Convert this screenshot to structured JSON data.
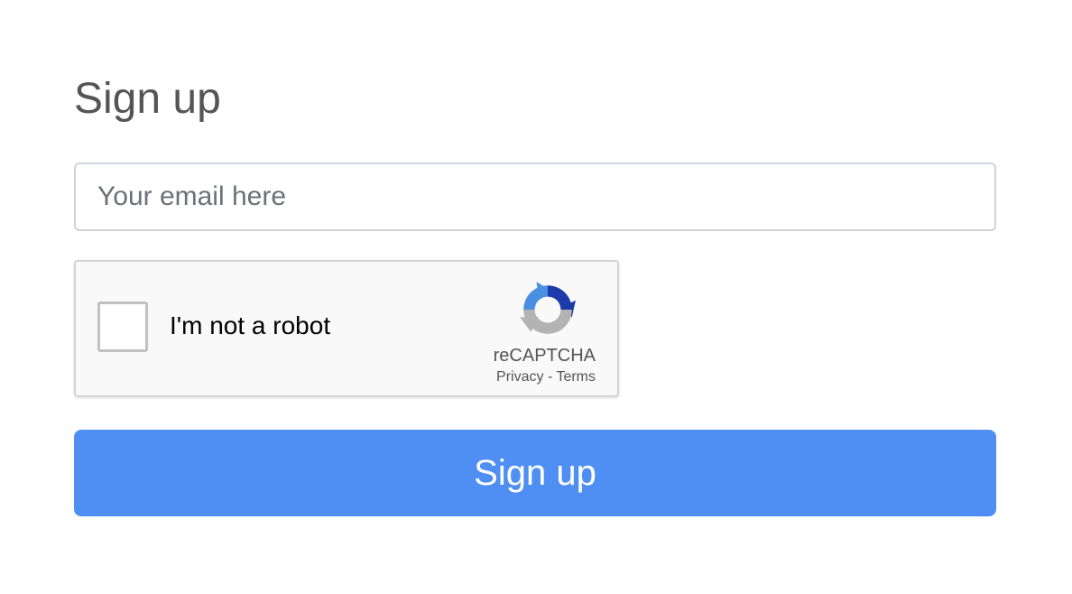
{
  "page": {
    "title": "Sign up"
  },
  "form": {
    "email_placeholder": "Your email here",
    "email_value": "",
    "submit_label": "Sign up"
  },
  "captcha": {
    "checkbox_label": "I'm not a robot",
    "checked": false,
    "brand": "reCAPTCHA",
    "privacy_label": "Privacy",
    "separator": " - ",
    "terms_label": "Terms",
    "icon": "recaptcha-logo-icon"
  },
  "colors": {
    "button_background": "#4f8ff3",
    "button_text": "#ffffff",
    "title_text": "#555555",
    "input_border": "#d0d3d7",
    "captcha_background": "#f9f9f9",
    "captcha_blue_dark": "#1c3aa9",
    "captcha_blue_light": "#4a90e2",
    "captcha_gray": "#b3b3b3"
  }
}
